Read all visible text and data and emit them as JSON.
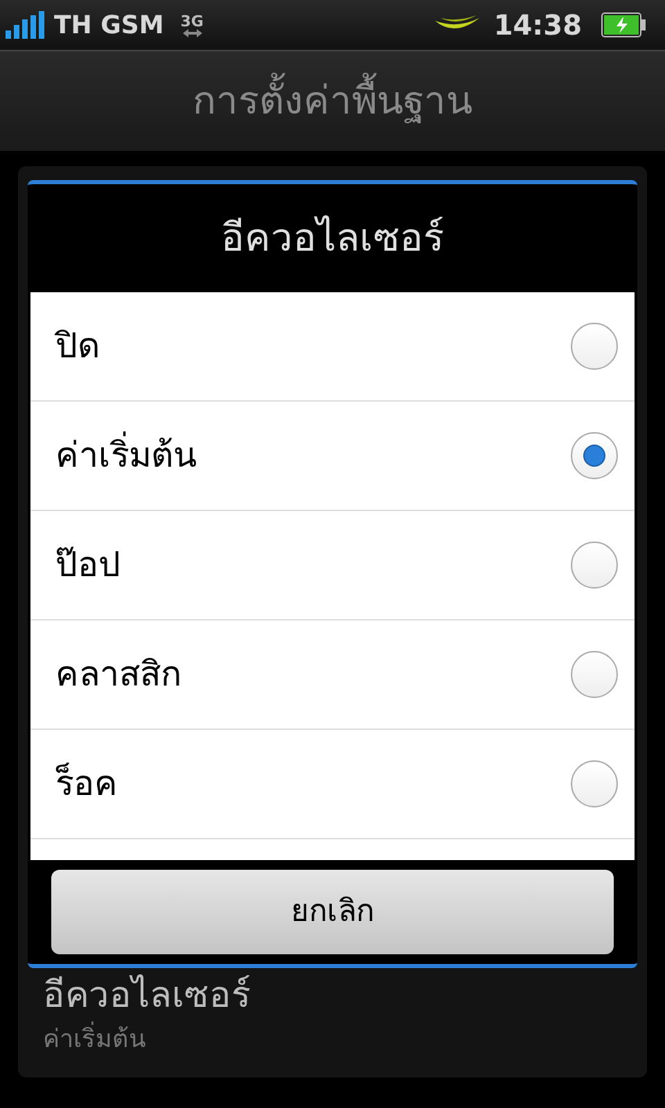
{
  "status_bar": {
    "carrier": "TH GSM",
    "network": "3G",
    "time": "14:38"
  },
  "screen_title": "การตั้งค่าพื้นฐาน",
  "settings_items": [
    {
      "title": "อีควอไลเซอร์",
      "summary": "ค่าเริ่มต้น"
    }
  ],
  "dialog": {
    "title": "อีควอไลเซอร์",
    "options": [
      {
        "label": "ปิด",
        "selected": false
      },
      {
        "label": "ค่าเริ่มต้น",
        "selected": true
      },
      {
        "label": "ป๊อป",
        "selected": false
      },
      {
        "label": "คลาสสิก",
        "selected": false
      },
      {
        "label": "ร็อค",
        "selected": false
      }
    ],
    "cancel_button": "ยกเลิก"
  }
}
